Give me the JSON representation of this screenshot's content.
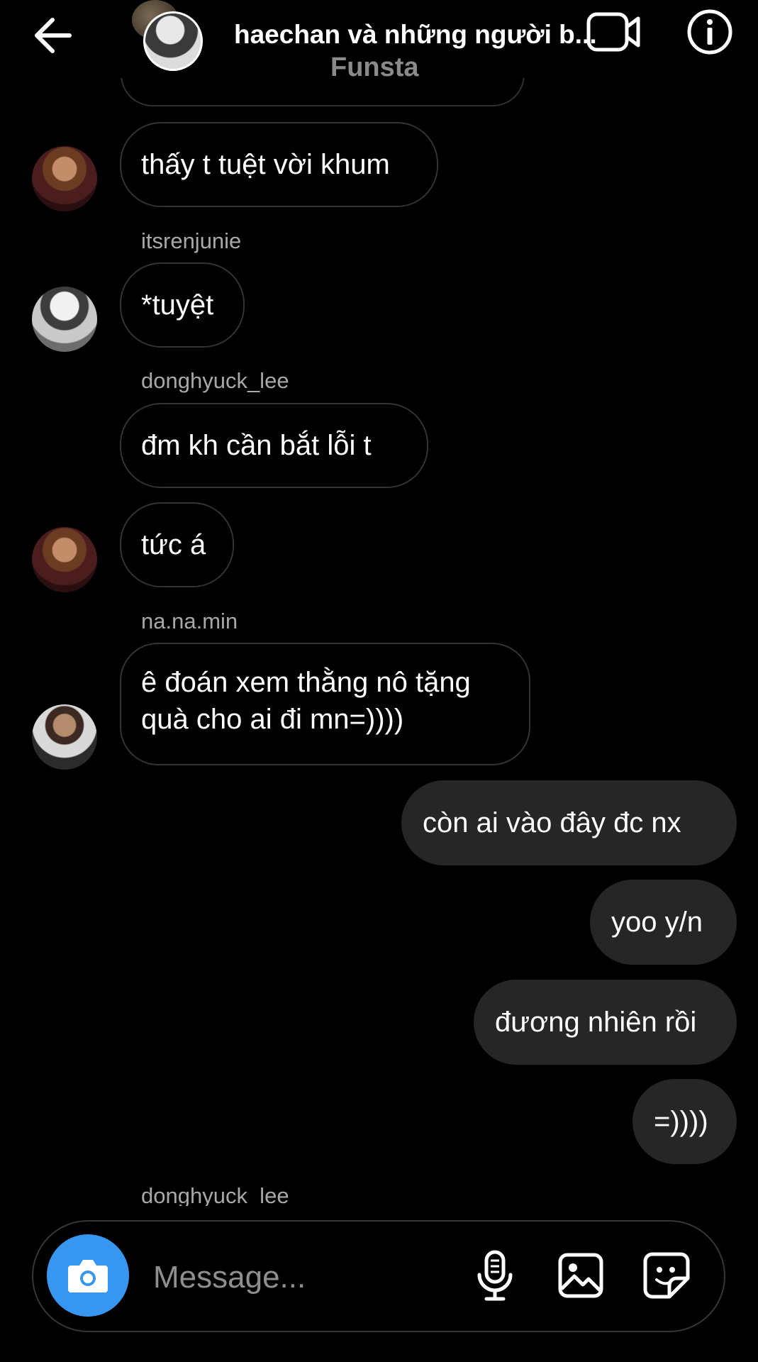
{
  "header": {
    "title": "haechan và những người b...",
    "subtitle": "Funsta",
    "icons": [
      "back-arrow-icon",
      "video-call-icon",
      "info-icon"
    ]
  },
  "messages": [
    {
      "from": "other",
      "text": "thấy t tuệt vời khum"
    },
    {
      "from": "other",
      "sender": "itsrenjunie",
      "text": "*tuyệt"
    },
    {
      "from": "other",
      "sender": "donghyuck_lee",
      "text": "đm kh cần bắt lỗi t"
    },
    {
      "from": "other",
      "text": "tức á"
    },
    {
      "from": "other",
      "sender": "na.na.min",
      "lines": [
        "ê đoán xem thằng nô tặng",
        "quà cho ai đi mn=))))"
      ]
    },
    {
      "from": "me",
      "text": "còn ai vào đây đc nx"
    },
    {
      "from": "me",
      "text": "yoo y/n"
    },
    {
      "from": "me",
      "text": "đương nhiên rồi"
    },
    {
      "from": "me",
      "text": "=))))"
    }
  ],
  "typing_sender": "donghyuck_lee",
  "composer": {
    "placeholder": "Message...",
    "icons": [
      "camera-icon",
      "microphone-icon",
      "gallery-icon",
      "sticker-icon"
    ]
  },
  "colors": {
    "background": "#000000",
    "my_bubble": "#262626",
    "camera_button": "#3797f0",
    "secondary_text": "#a8a8a8"
  }
}
